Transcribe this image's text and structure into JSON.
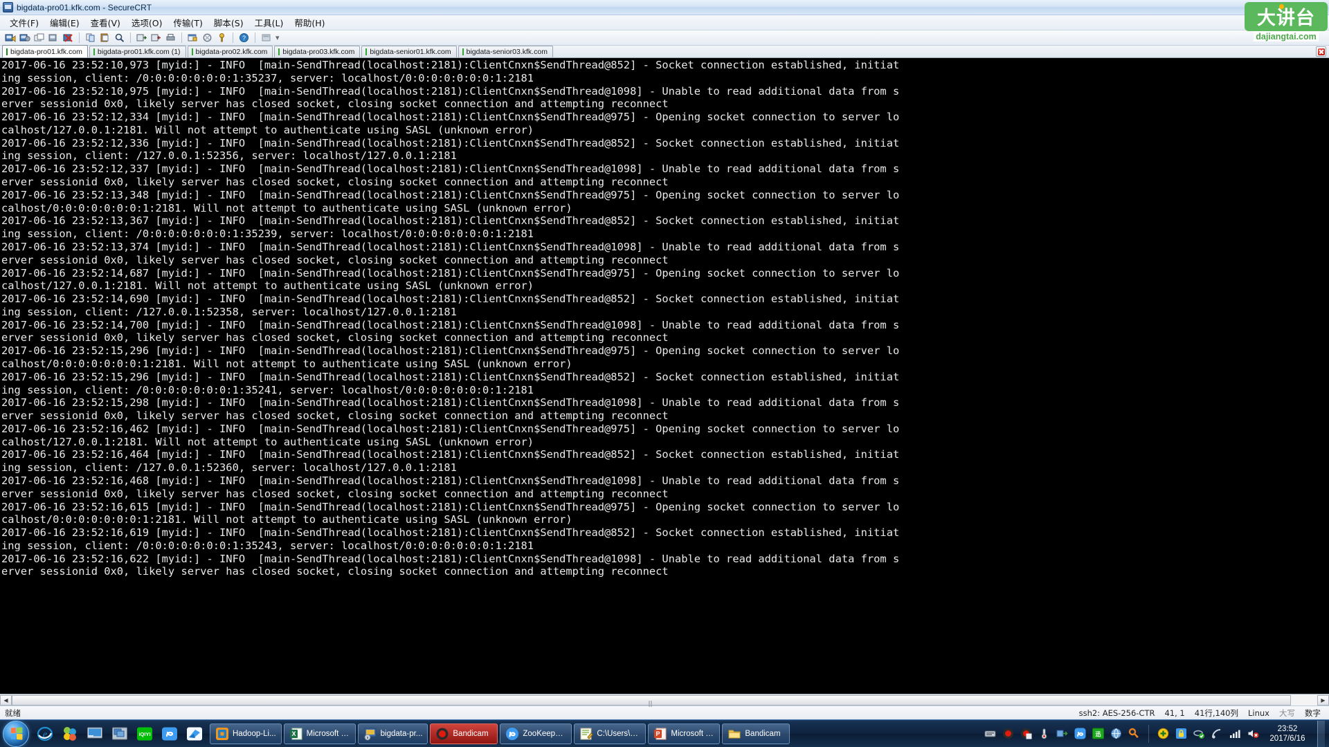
{
  "window": {
    "title": "bigdata-pro01.kfk.com - SecureCRT",
    "app_icon": "securecrt-icon"
  },
  "menubar": {
    "items": [
      {
        "label": "文件(F)",
        "name": "menu-file"
      },
      {
        "label": "编辑(E)",
        "name": "menu-edit"
      },
      {
        "label": "查看(V)",
        "name": "menu-view"
      },
      {
        "label": "选项(O)",
        "name": "menu-options"
      },
      {
        "label": "传输(T)",
        "name": "menu-transfer"
      },
      {
        "label": "脚本(S)",
        "name": "menu-script"
      },
      {
        "label": "工具(L)",
        "name": "menu-tools"
      },
      {
        "label": "帮助(H)",
        "name": "menu-help"
      }
    ]
  },
  "toolbar": {
    "buttons": [
      "new-session-icon",
      "clone-session-icon",
      "new-tab-icon",
      "connect-sftp-icon",
      "disconnect-icon",
      "copy-icon",
      "paste-icon",
      "find-icon",
      "log-session-icon",
      "raw-log-icon",
      "print-icon",
      "session-options-icon",
      "global-options-icon",
      "keymap-icon",
      "help-icon",
      "window-arrange-icon"
    ]
  },
  "tabs": {
    "items": [
      {
        "label": "bigdata-pro01.kfk.com",
        "active": true
      },
      {
        "label": "bigdata-pro01.kfk.com (1)",
        "active": false
      },
      {
        "label": "bigdata-pro02.kfk.com",
        "active": false
      },
      {
        "label": "bigdata-pro03.kfk.com",
        "active": false
      },
      {
        "label": "bigdata-senior01.kfk.com",
        "active": false
      },
      {
        "label": "bigdata-senior03.kfk.com",
        "active": false
      }
    ],
    "close_label": "close-tab"
  },
  "terminal": {
    "lines": [
      "2017-06-16 23:52:10,973 [myid:] - INFO  [main-SendThread(localhost:2181):ClientCnxn$SendThread@852] - Socket connection established, initiat",
      "ing session, client: /0:0:0:0:0:0:0:1:35237, server: localhost/0:0:0:0:0:0:0:1:2181",
      "2017-06-16 23:52:10,975 [myid:] - INFO  [main-SendThread(localhost:2181):ClientCnxn$SendThread@1098] - Unable to read additional data from s",
      "erver sessionid 0x0, likely server has closed socket, closing socket connection and attempting reconnect",
      "2017-06-16 23:52:12,334 [myid:] - INFO  [main-SendThread(localhost:2181):ClientCnxn$SendThread@975] - Opening socket connection to server lo",
      "calhost/127.0.0.1:2181. Will not attempt to authenticate using SASL (unknown error)",
      "2017-06-16 23:52:12,336 [myid:] - INFO  [main-SendThread(localhost:2181):ClientCnxn$SendThread@852] - Socket connection established, initiat",
      "ing session, client: /127.0.0.1:52356, server: localhost/127.0.0.1:2181",
      "2017-06-16 23:52:12,337 [myid:] - INFO  [main-SendThread(localhost:2181):ClientCnxn$SendThread@1098] - Unable to read additional data from s",
      "erver sessionid 0x0, likely server has closed socket, closing socket connection and attempting reconnect",
      "2017-06-16 23:52:13,348 [myid:] - INFO  [main-SendThread(localhost:2181):ClientCnxn$SendThread@975] - Opening socket connection to server lo",
      "calhost/0:0:0:0:0:0:0:1:2181. Will not attempt to authenticate using SASL (unknown error)",
      "2017-06-16 23:52:13,367 [myid:] - INFO  [main-SendThread(localhost:2181):ClientCnxn$SendThread@852] - Socket connection established, initiat",
      "ing session, client: /0:0:0:0:0:0:0:1:35239, server: localhost/0:0:0:0:0:0:0:1:2181",
      "2017-06-16 23:52:13,374 [myid:] - INFO  [main-SendThread(localhost:2181):ClientCnxn$SendThread@1098] - Unable to read additional data from s",
      "erver sessionid 0x0, likely server has closed socket, closing socket connection and attempting reconnect",
      "2017-06-16 23:52:14,687 [myid:] - INFO  [main-SendThread(localhost:2181):ClientCnxn$SendThread@975] - Opening socket connection to server lo",
      "calhost/127.0.0.1:2181. Will not attempt to authenticate using SASL (unknown error)",
      "2017-06-16 23:52:14,690 [myid:] - INFO  [main-SendThread(localhost:2181):ClientCnxn$SendThread@852] - Socket connection established, initiat",
      "ing session, client: /127.0.0.1:52358, server: localhost/127.0.0.1:2181",
      "2017-06-16 23:52:14,700 [myid:] - INFO  [main-SendThread(localhost:2181):ClientCnxn$SendThread@1098] - Unable to read additional data from s",
      "erver sessionid 0x0, likely server has closed socket, closing socket connection and attempting reconnect",
      "2017-06-16 23:52:15,296 [myid:] - INFO  [main-SendThread(localhost:2181):ClientCnxn$SendThread@975] - Opening socket connection to server lo",
      "calhost/0:0:0:0:0:0:0:1:2181. Will not attempt to authenticate using SASL (unknown error)",
      "2017-06-16 23:52:15,296 [myid:] - INFO  [main-SendThread(localhost:2181):ClientCnxn$SendThread@852] - Socket connection established, initiat",
      "ing session, client: /0:0:0:0:0:0:0:1:35241, server: localhost/0:0:0:0:0:0:0:1:2181",
      "2017-06-16 23:52:15,298 [myid:] - INFO  [main-SendThread(localhost:2181):ClientCnxn$SendThread@1098] - Unable to read additional data from s",
      "erver sessionid 0x0, likely server has closed socket, closing socket connection and attempting reconnect",
      "2017-06-16 23:52:16,462 [myid:] - INFO  [main-SendThread(localhost:2181):ClientCnxn$SendThread@975] - Opening socket connection to server lo",
      "calhost/127.0.0.1:2181. Will not attempt to authenticate using SASL (unknown error)",
      "2017-06-16 23:52:16,464 [myid:] - INFO  [main-SendThread(localhost:2181):ClientCnxn$SendThread@852] - Socket connection established, initiat",
      "ing session, client: /127.0.0.1:52360, server: localhost/127.0.0.1:2181",
      "2017-06-16 23:52:16,468 [myid:] - INFO  [main-SendThread(localhost:2181):ClientCnxn$SendThread@1098] - Unable to read additional data from s",
      "erver sessionid 0x0, likely server has closed socket, closing socket connection and attempting reconnect",
      "2017-06-16 23:52:16,615 [myid:] - INFO  [main-SendThread(localhost:2181):ClientCnxn$SendThread@975] - Opening socket connection to server lo",
      "calhost/0:0:0:0:0:0:0:1:2181. Will not attempt to authenticate using SASL (unknown error)",
      "2017-06-16 23:52:16,619 [myid:] - INFO  [main-SendThread(localhost:2181):ClientCnxn$SendThread@852] - Socket connection established, initiat",
      "ing session, client: /0:0:0:0:0:0:0:1:35243, server: localhost/0:0:0:0:0:0:0:1:2181",
      "2017-06-16 23:52:16,622 [myid:] - INFO  [main-SendThread(localhost:2181):ClientCnxn$SendThread@1098] - Unable to read additional data from s",
      "erver sessionid 0x0, likely server has closed socket, closing socket connection and attempting reconnect"
    ],
    "fg_color": "#e9e9e9",
    "bg_color": "#000000"
  },
  "statusbar": {
    "ready": "就绪",
    "protocol": "ssh2: AES-256-CTR",
    "cursor": "41, 1",
    "size": "41行,140列",
    "platform": "Linux",
    "caps": "大写",
    "num": "数字"
  },
  "taskbar": {
    "start_label": "start-orb",
    "quick_launch": [
      {
        "name": "internet-explorer-icon"
      },
      {
        "name": "bubbles-icon"
      },
      {
        "name": "show-desktop-icon"
      },
      {
        "name": "switch-windows-icon"
      },
      {
        "name": "iqiyi-icon"
      },
      {
        "name": "sogou-icon"
      },
      {
        "name": "foxmail-icon"
      }
    ],
    "buttons": [
      {
        "label": "Hadoop-Li...",
        "icon": "vmware-icon",
        "active": false
      },
      {
        "label": "Microsoft E...",
        "icon": "excel-icon",
        "active": false
      },
      {
        "label": "bigdata-pr...",
        "icon": "securecrt-icon",
        "active": true
      },
      {
        "label": "Bandicam",
        "icon": "bandicam-record-icon",
        "active": false,
        "recording": true
      },
      {
        "label": "ZooKeeper...",
        "icon": "sogou-browser-icon",
        "active": false
      },
      {
        "label": "C:\\Users\\A...",
        "icon": "editplus-icon",
        "active": false
      },
      {
        "label": "Microsoft P...",
        "icon": "powerpoint-icon",
        "active": false
      },
      {
        "label": "Bandicam",
        "icon": "folder-icon",
        "active": false
      }
    ],
    "tray": [
      {
        "name": "bandizip-icon"
      },
      {
        "name": "bandicam-record-icon"
      },
      {
        "name": "bandicut-icon"
      },
      {
        "name": "thermometer-icon"
      },
      {
        "name": "driver-icon"
      },
      {
        "name": "sogou-pinyin-icon"
      },
      {
        "name": "green-app-icon"
      },
      {
        "name": "world-icon"
      },
      {
        "name": "key-icon"
      },
      {
        "name": "update-icon"
      },
      {
        "name": "security-icon"
      },
      {
        "name": "network-ok-icon"
      },
      {
        "name": "satellite-icon"
      },
      {
        "name": "signal-icon"
      },
      {
        "name": "volume-muted-icon"
      }
    ],
    "clock_time": "23:52",
    "clock_date": "2017/6/16"
  },
  "watermark": {
    "cn": "大讲台",
    "url": "dajiangtai.com",
    "color": "#5cb85c"
  }
}
